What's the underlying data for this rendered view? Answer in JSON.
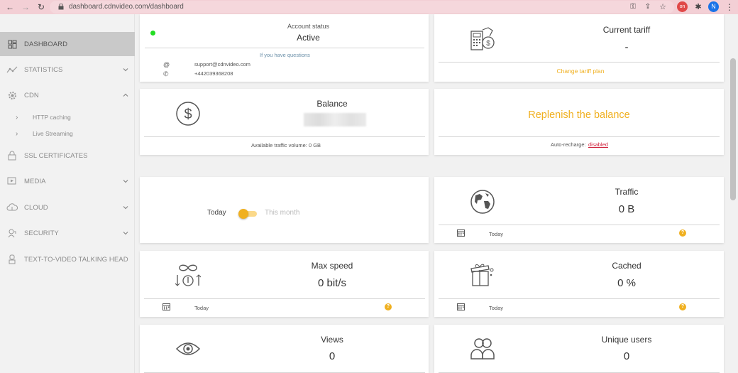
{
  "browser": {
    "url": "dashboard.cdnvideo.com/dashboard",
    "profile_initial": "N"
  },
  "sidebar": {
    "items": [
      {
        "label": "DASHBOARD",
        "icon": "dashboard-icon"
      },
      {
        "label": "STATISTICS",
        "icon": "statistics-icon"
      },
      {
        "label": "CDN",
        "icon": "cdn-gear-icon"
      },
      {
        "label": "SSL CERTIFICATES",
        "icon": "lock-icon"
      },
      {
        "label": "MEDIA",
        "icon": "media-icon"
      },
      {
        "label": "CLOUD",
        "icon": "cloud-icon"
      },
      {
        "label": "SECURITY",
        "icon": "security-icon"
      },
      {
        "label": "TEXT-TO-VIDEO TALKING HEAD",
        "icon": "talking-head-icon"
      }
    ],
    "cdn_sub": [
      "HTTP caching",
      "Live Streaming"
    ]
  },
  "account": {
    "title": "Account status",
    "status": "Active",
    "questions": "If you have questions",
    "email": "support@cdnvideo.com",
    "phone": "+442039368208"
  },
  "tariff": {
    "title": "Current tariff",
    "value": "-",
    "change_link": "Change tariff plan"
  },
  "balance": {
    "title": "Balance",
    "available": "Available traffic volume: 0 GB"
  },
  "replenish": {
    "label": "Replenish the balance",
    "auto_label": "Auto-recharge:",
    "auto_value": "disabled"
  },
  "period": {
    "left": "Today",
    "right": "This month"
  },
  "traffic": {
    "title": "Traffic",
    "value": "0 B",
    "period": "Today"
  },
  "max_speed": {
    "title": "Max speed",
    "value": "0 bit/s",
    "period": "Today"
  },
  "cached": {
    "title": "Cached",
    "value": "0 %",
    "period": "Today"
  },
  "views": {
    "title": "Views",
    "value": "0"
  },
  "unique": {
    "title": "Unique users",
    "value": "0"
  },
  "colors": {
    "accent": "#f0b020",
    "status_green": "#22dd22",
    "link_red": "#d0213b",
    "sidebar_active": "#c9c9c9"
  }
}
